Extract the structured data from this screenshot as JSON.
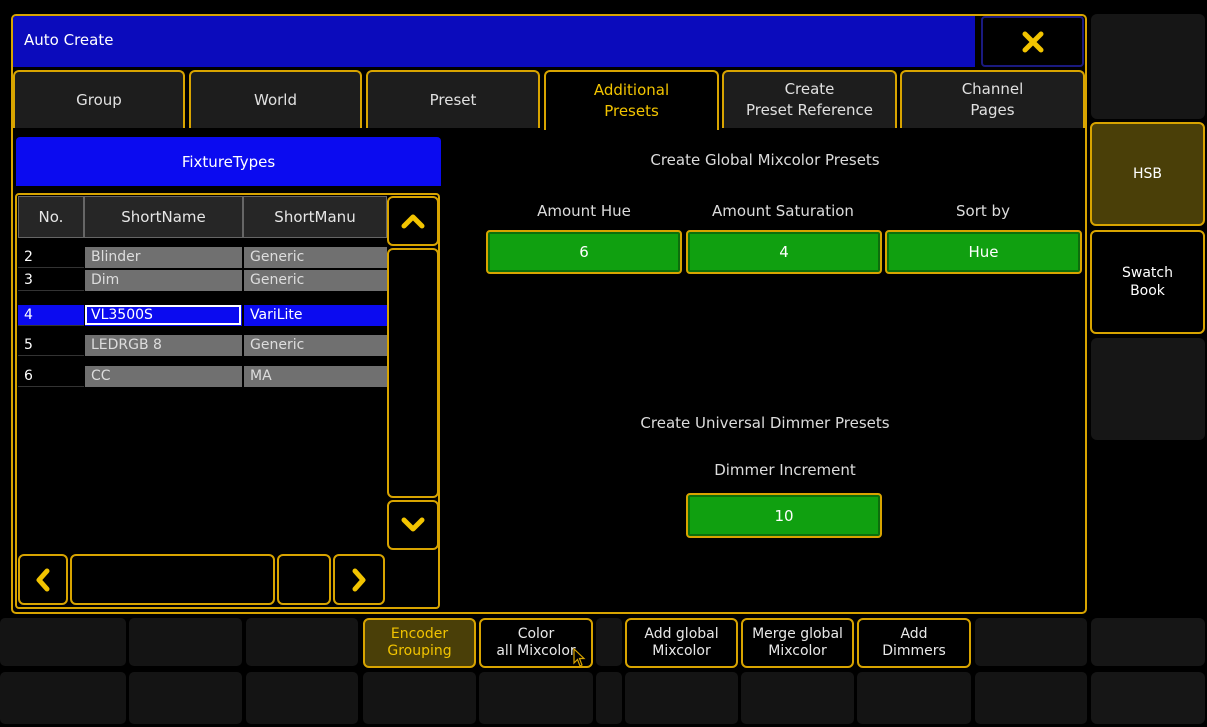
{
  "window": {
    "title": "Auto Create",
    "close_icon": "close-x-icon"
  },
  "tabs": [
    {
      "line1": "Group",
      "line2": ""
    },
    {
      "line1": "World",
      "line2": ""
    },
    {
      "line1": "Preset",
      "line2": ""
    },
    {
      "line1": "Additional",
      "line2": "Presets"
    },
    {
      "line1": "Create",
      "line2": "Preset Reference"
    },
    {
      "line1": "Channel",
      "line2": "Pages"
    }
  ],
  "fixture_types": {
    "header": "FixtureTypes",
    "columns": [
      "No.",
      "ShortName",
      "ShortManu"
    ],
    "rows": [
      {
        "no": "2",
        "name": "Blinder",
        "manu": "Generic"
      },
      {
        "no": "3",
        "name": "Dim",
        "manu": "Generic"
      },
      {
        "no": "4",
        "name": "VL3500S",
        "manu": "VariLite"
      },
      {
        "no": "5",
        "name": "LEDRGB 8",
        "manu": "Generic"
      },
      {
        "no": "6",
        "name": "CC",
        "manu": "MA"
      }
    ],
    "selected_row": "4"
  },
  "mixcolor": {
    "title": "Create Global Mixcolor Presets",
    "hue_label": "Amount Hue",
    "hue_value": "6",
    "sat_label": "Amount Saturation",
    "sat_value": "4",
    "sort_label": "Sort by",
    "sort_value": "Hue"
  },
  "dimmer": {
    "title": "Create Universal Dimmer Presets",
    "increment_label": "Dimmer Increment",
    "increment_value": "10"
  },
  "side_buttons": {
    "hsb": "HSB",
    "swatch_line1": "Swatch",
    "swatch_line2": "Book"
  },
  "bottom_buttons": [
    {
      "line1": "Encoder",
      "line2": "Grouping"
    },
    {
      "line1": "Color",
      "line2": "all Mixcolor"
    },
    {
      "line1": "Add global",
      "line2": "Mixcolor"
    },
    {
      "line1": "Merge global",
      "line2": "Mixcolor"
    },
    {
      "line1": "Add",
      "line2": "Dimmers"
    }
  ],
  "colors": {
    "accent": "#d8a400",
    "title_bar": "#0b0bbc",
    "selection": "#0b0bf0",
    "value_button": "#10a010"
  }
}
